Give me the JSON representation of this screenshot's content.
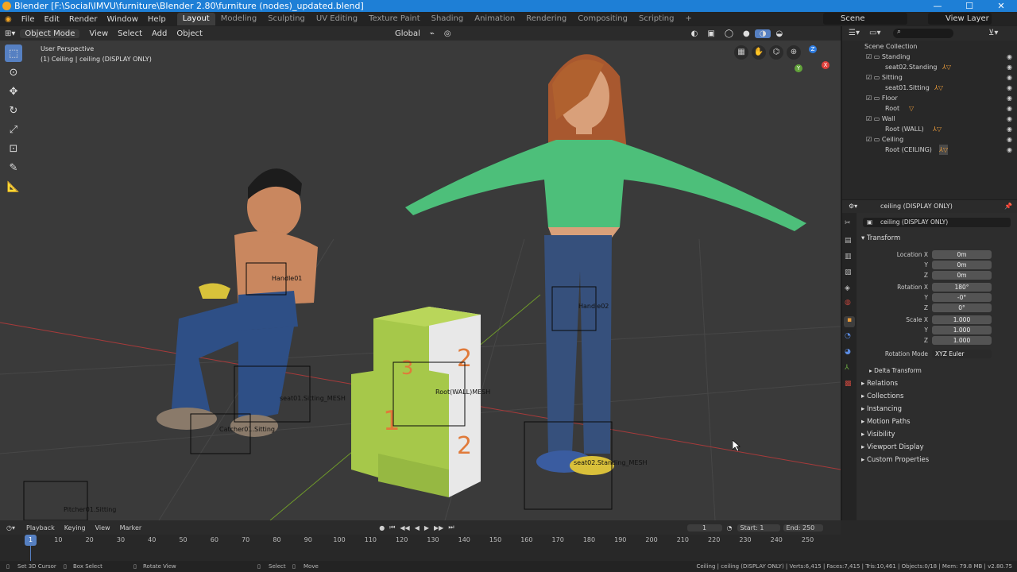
{
  "window": {
    "title": "Blender [F:\\Social\\IMVU\\furniture\\Blender 2.80\\furniture (nodes)_updated.blend]",
    "controls": [
      "—",
      "☐",
      "✕"
    ]
  },
  "menu": [
    "File",
    "Edit",
    "Render",
    "Window",
    "Help"
  ],
  "workspaces": [
    "Layout",
    "Modeling",
    "Sculpting",
    "UV Editing",
    "Texture Paint",
    "Shading",
    "Animation",
    "Rendering",
    "Compositing",
    "Scripting",
    "+"
  ],
  "scene": "Scene",
  "view_layer": "View Layer",
  "viewport_header": {
    "mode": "Object Mode",
    "menus": [
      "View",
      "Select",
      "Add",
      "Object"
    ],
    "orientation": "Global"
  },
  "viewport": {
    "perspective_label": "User Perspective",
    "object_info": "(1) Ceiling | ceiling (DISPLAY ONLY)",
    "labels": [
      "Handle01",
      "Handle02",
      "seat01.Sitting_MESH",
      "Catcher01.Sitting",
      "Pitcher01.Sitting",
      "seat02.Standing_MESH",
      "Root(WALL)MESH"
    ],
    "axis_labels": [
      "X",
      "Y",
      "Z"
    ]
  },
  "outliner": {
    "title": "Scene Collection",
    "items": [
      {
        "label": "Standing",
        "type": "collection"
      },
      {
        "label": "seat02.Standing",
        "type": "object"
      },
      {
        "label": "Sitting",
        "type": "collection"
      },
      {
        "label": "seat01.Sitting",
        "type": "object"
      },
      {
        "label": "Floor",
        "type": "collection"
      },
      {
        "label": "Root",
        "type": "object"
      },
      {
        "label": "Wall",
        "type": "collection"
      },
      {
        "label": "Root (WALL)",
        "type": "object"
      },
      {
        "label": "Ceiling",
        "type": "collection"
      },
      {
        "label": "Root (CEILING)",
        "type": "object"
      }
    ]
  },
  "properties": {
    "object_name": "ceiling (DISPLAY ONLY)",
    "object_field": "ceiling (DISPLAY ONLY)",
    "transform_title": "Transform",
    "rows": [
      {
        "label": "Location X",
        "value": "0m"
      },
      {
        "label": "Y",
        "value": "0m"
      },
      {
        "label": "Z",
        "value": "0m"
      },
      {
        "label": "Rotation X",
        "value": "180°"
      },
      {
        "label": "Y",
        "value": "-0°"
      },
      {
        "label": "Z",
        "value": "0°"
      },
      {
        "label": "Scale X",
        "value": "1.000"
      },
      {
        "label": "Y",
        "value": "1.000"
      },
      {
        "label": "Z",
        "value": "1.000"
      }
    ],
    "rotation_mode_label": "Rotation Mode",
    "rotation_mode_value": "XYZ Euler",
    "delta_transform": "Delta Transform",
    "panels": [
      "Relations",
      "Collections",
      "Instancing",
      "Motion Paths",
      "Visibility",
      "Viewport Display",
      "Custom Properties"
    ]
  },
  "timeline": {
    "menus": [
      "Playback",
      "Keying",
      "View",
      "Marker"
    ],
    "current_frame": "1",
    "start_label": "Start:",
    "start": "1",
    "end_label": "End:",
    "end": "250",
    "ticks": [
      "1",
      "10",
      "20",
      "30",
      "40",
      "50",
      "60",
      "70",
      "80",
      "90",
      "100",
      "110",
      "120",
      "130",
      "140",
      "150",
      "160",
      "170",
      "180",
      "190",
      "200",
      "210",
      "220",
      "230",
      "240",
      "250"
    ]
  },
  "status": {
    "left": [
      "Set 3D Cursor",
      "Box Select",
      "Rotate View"
    ],
    "middle": [
      "Select",
      "Move"
    ],
    "right": "Ceiling | ceiling (DISPLAY ONLY) | Verts:6,415 | Faces:7,415 | Tris:10,461 | Objects:0/18 | Mem: 79.8 MB | v2.80.75"
  },
  "colors": {
    "accent": "#5680c2",
    "title_bar": "#1e7fd6",
    "viewport_bg": "#3a3a3a",
    "block_green": "#a6c84a",
    "block_orange": "#e07a3a"
  }
}
